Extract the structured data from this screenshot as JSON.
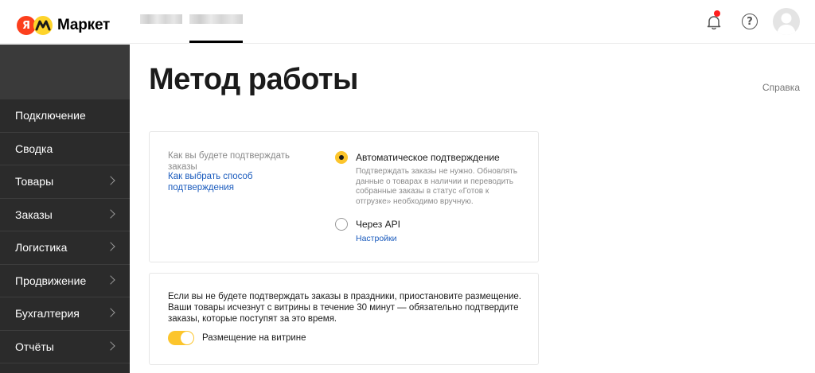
{
  "header": {
    "logo_ya": "Я",
    "logo_text": "Маркет",
    "top_tabs": [
      "",
      ""
    ],
    "icons": {
      "notifications": "bell-icon",
      "help": "question-icon",
      "avatar": "user-avatar"
    },
    "help_symbol": "?"
  },
  "sidebar": {
    "items": [
      {
        "label": "Подключение",
        "has_chevron": false
      },
      {
        "label": "Сводка",
        "has_chevron": false
      },
      {
        "label": "Товары",
        "has_chevron": true
      },
      {
        "label": "Заказы",
        "has_chevron": true
      },
      {
        "label": "Логистика",
        "has_chevron": true
      },
      {
        "label": "Продвижение",
        "has_chevron": true
      },
      {
        "label": "Бухгалтерия",
        "has_chevron": true
      },
      {
        "label": "Отчёты",
        "has_chevron": true
      }
    ]
  },
  "main": {
    "title": "Метод работы",
    "help_link": "Справка",
    "method_card": {
      "label": "Как вы будете подтверждать заказы",
      "link": "Как выбрать способ подтверждения",
      "options": [
        {
          "title": "Автоматическое подтверждение",
          "description": "Подтверждать заказы не нужно. Обновлять данные о товарах в наличии и переводить собранные заказы в статус «Готов к отгрузке» необходимо вручную.",
          "selected": true
        },
        {
          "title": "Через API",
          "link": "Настройки",
          "selected": false
        }
      ]
    },
    "placement_card": {
      "text": "Если вы не будете подтверждать заказы в праздники, приостановите размещение. Ваши товары исчезнут с витрины в течение 30 минут — обязательно подтвердите заказы, которые поступят за это время.",
      "toggle_label": "Размещение на витрине",
      "toggle_on": true
    }
  },
  "colors": {
    "accent": "#fcc52c",
    "link": "#1a5bbd",
    "sidebar_bg": "#2b2b2b",
    "notification_dot": "#ff1e1e",
    "logo_red": "#fc3f1d",
    "logo_yellow": "#fed42b"
  }
}
